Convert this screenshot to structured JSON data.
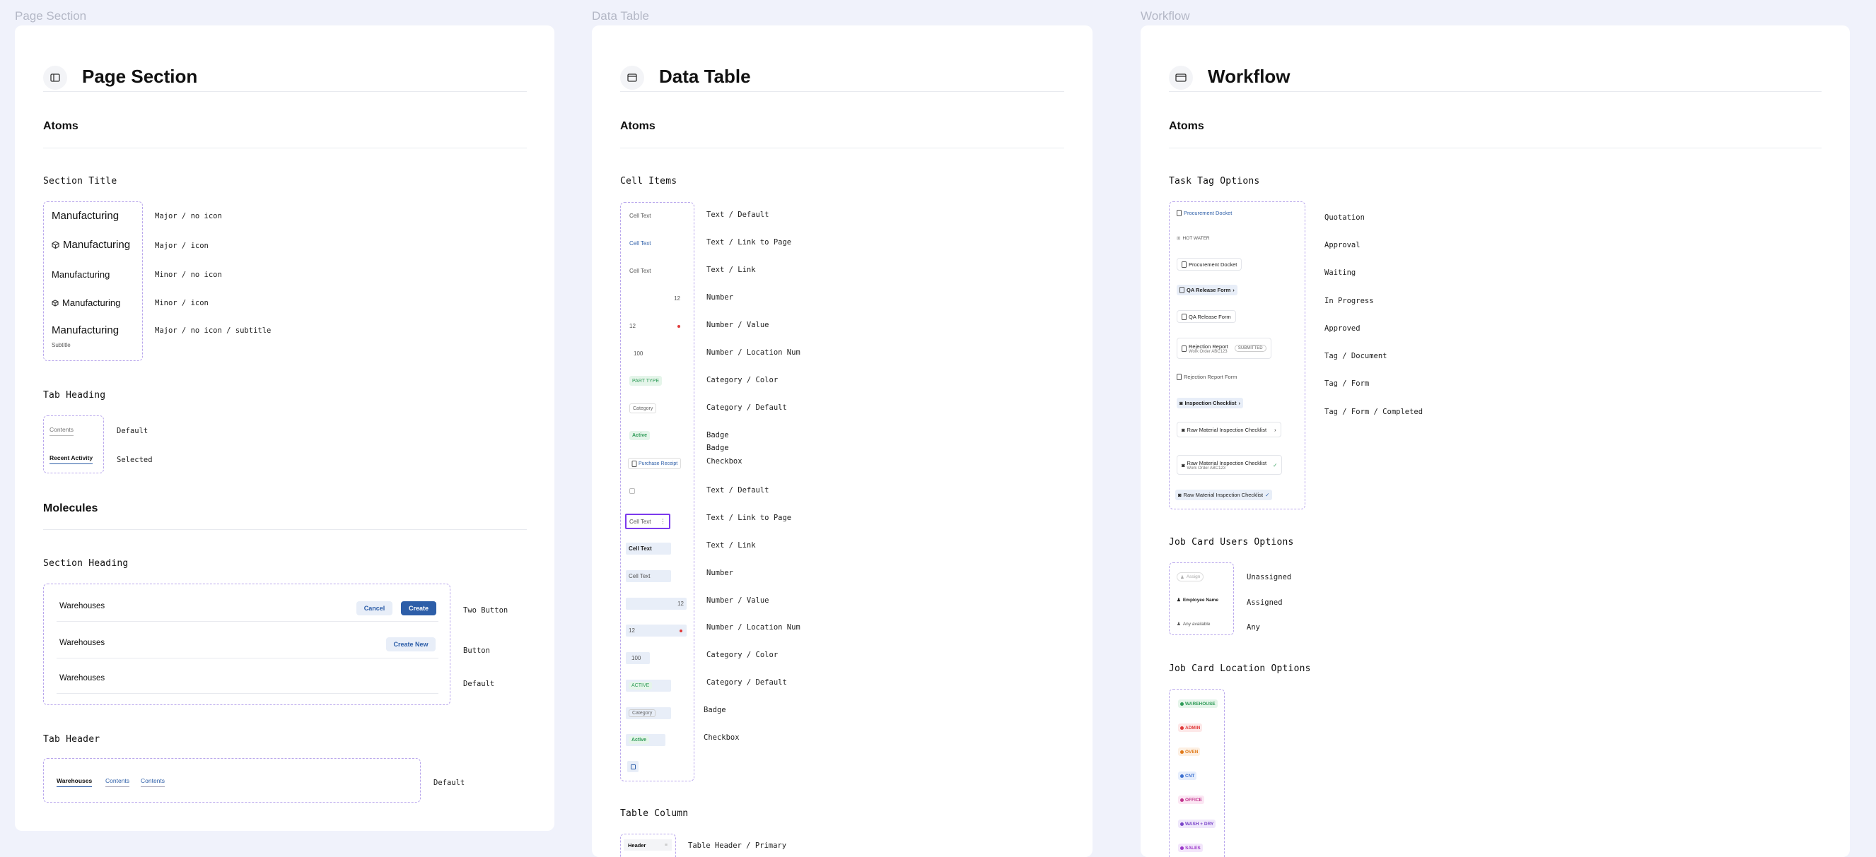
{
  "pages": {
    "section": "Page Section",
    "table": "Data Table",
    "workflow": "Workflow"
  },
  "common": {
    "atoms": "Atoms",
    "molecules": "Molecules"
  },
  "section": {
    "section_title": {
      "heading": "Section Title",
      "items": [
        {
          "text": "Manufacturing",
          "label": "Major / no icon"
        },
        {
          "text": "Manufacturing",
          "label": "Major / icon"
        },
        {
          "text": "Manufacturing",
          "label": "Minor / no icon"
        },
        {
          "text": "Manufacturing",
          "label": "Minor / icon"
        },
        {
          "text": "Manufacturing",
          "subtitle": "Subtitle",
          "label": "Major / no icon / subtitle"
        }
      ]
    },
    "tab_heading": {
      "heading": "Tab Heading",
      "items": [
        {
          "text": "Contents",
          "label": "Default"
        },
        {
          "text": "Recent Activity",
          "label": "Selected"
        }
      ]
    },
    "section_heading": {
      "heading": "Section Heading",
      "items": [
        {
          "text": "Warehouses",
          "label": "Two Button",
          "cancel": "Cancel",
          "create": "Create"
        },
        {
          "text": "Warehouses",
          "label": "Button",
          "create_new": "Create New"
        },
        {
          "text": "Warehouses",
          "label": "Default"
        }
      ]
    },
    "tab_header": {
      "heading": "Tab Header",
      "tabs": [
        "Warehouses",
        "Contents",
        "Contents"
      ],
      "label": "Default"
    }
  },
  "table": {
    "cell_items": {
      "heading": "Cell Items",
      "cells": [
        {
          "text": "Cell Text",
          "label": "Text / Default"
        },
        {
          "text": "Cell Text",
          "label": "Text / Link to Page"
        },
        {
          "text": "Cell Text",
          "label": "Text / Link"
        },
        {
          "text": "12",
          "label": "Number"
        },
        {
          "text": "12",
          "label": "Number / Value"
        },
        {
          "text": "100",
          "label": "Number / Location Num"
        },
        {
          "text": "PART TYPE",
          "label": "Category / Color"
        },
        {
          "text": "Category",
          "label": "Category / Default"
        },
        {
          "text": "Active",
          "label": "Badge"
        },
        {
          "text": "Purchase Receipt",
          "label": "Checkbox"
        },
        {
          "text": "",
          "label": "Text / Default"
        },
        {
          "text": "Cell Text",
          "label": "Text / Link to Page"
        },
        {
          "text": "Cell Text",
          "label": "Text / Link"
        },
        {
          "text": "Cell Text",
          "label": "Number"
        },
        {
          "text": "12",
          "label": "Number / Value"
        },
        {
          "text": "12",
          "label": "Number / Location Num"
        },
        {
          "text": "100",
          "label": "Category / Color"
        },
        {
          "text": "ACTIVE",
          "label": "Category / Default"
        },
        {
          "text": "Category",
          "label": "Badge"
        },
        {
          "text": "Active",
          "label": "Checkbox"
        }
      ],
      "extra_badge_label": "Badge"
    },
    "table_column": {
      "heading": "Table Column",
      "header_text": "Header",
      "label": "Table Header / Primary"
    }
  },
  "workflow": {
    "task_tag": {
      "heading": "Task Tag Options",
      "tags": [
        "Procurement Docket",
        "HOT WATER",
        "Procurement Docket",
        "QA Release Form",
        "QA Release Form",
        "Rejection Report",
        "Rejection Report Form",
        "Inspection Checklist",
        "Raw Material Inspection Checklist",
        "Raw Material Inspection Checklist",
        "Raw Material Inspection Checklist"
      ],
      "sub_work_order": "Work Order ABC123",
      "submitted": "SUBMITTED",
      "labels": [
        "Quotation",
        "Approval",
        "Waiting",
        "In Progress",
        "Approved",
        "Tag / Document",
        "Tag / Form",
        "Tag / Form / Completed"
      ]
    },
    "job_users": {
      "heading": "Job Card Users Options",
      "items": [
        {
          "text": "Assign",
          "label": "Unassigned"
        },
        {
          "text": "Employee Name",
          "label": "Assigned"
        },
        {
          "text": "Any available",
          "label": "Any"
        }
      ]
    },
    "job_location": {
      "heading": "Job Card Location Options",
      "items": [
        {
          "text": "WAREHOUSE",
          "color": "#2e9b57",
          "bg": "#e5f5ea"
        },
        {
          "text": "ADMIN",
          "color": "#e03a3a",
          "bg": "#fde8e8"
        },
        {
          "text": "OVEN",
          "color": "#e07a1a",
          "bg": "#fdf0e3"
        },
        {
          "text": "CNT",
          "color": "#3a6fd0",
          "bg": "#e6eefc"
        },
        {
          "text": "OFFICE",
          "color": "#c2338c",
          "bg": "#fbe6f3"
        },
        {
          "text": "WASH + DRY",
          "color": "#7a45c9",
          "bg": "#efe7fb"
        },
        {
          "text": "SALES",
          "color": "#9b38c9",
          "bg": "#f3e6fb"
        }
      ]
    }
  },
  "colors": {
    "accent": "#2d5ea8",
    "dash": "#b9a7ec",
    "selected_outline": "#7c3aed"
  }
}
